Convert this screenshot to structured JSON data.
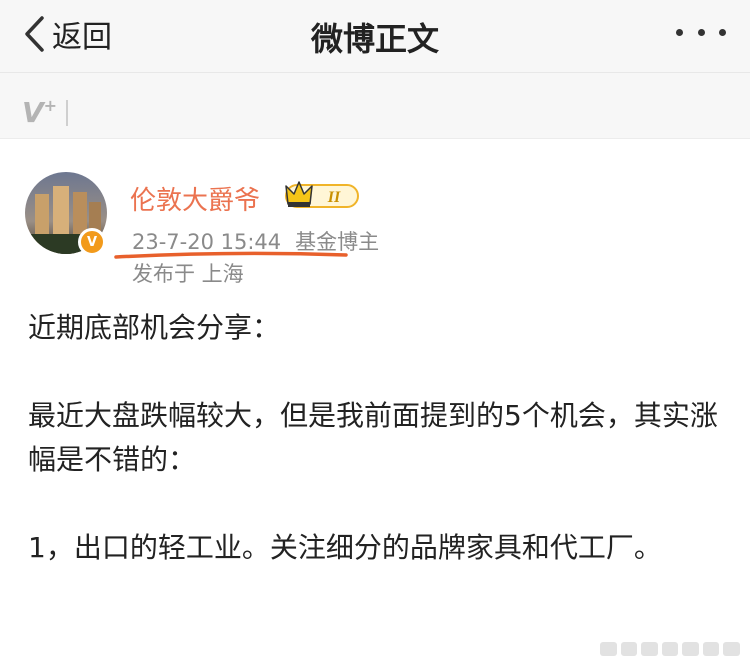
{
  "nav": {
    "back_label": "返回",
    "title": "微博正文"
  },
  "user": {
    "name": "伦敦大爵爷",
    "vip_level": "II",
    "verified_mark": "V",
    "time": "23-7-20 15:44",
    "role": "基金博主",
    "location": "发布于 上海"
  },
  "watermark": {
    "mark": "V",
    "plus": "+"
  },
  "post": {
    "paragraphs": [
      "近期底部机会分享：",
      "最近大盘跌幅较大，但是我前面提到的5个机会，其实涨幅是不错的：",
      "1，出口的轻工业。关注细分的品牌家具和代工厂。"
    ]
  },
  "colors": {
    "username": "#eb7350",
    "meta_text": "#8a8a8a",
    "underline_annotation": "#e8602c",
    "verified_badge": "#f29a1b",
    "vip_crown": "#f5c518"
  },
  "icons": [
    "chevron-left-icon",
    "more-dots-icon",
    "crown-icon",
    "verified-icon"
  ]
}
